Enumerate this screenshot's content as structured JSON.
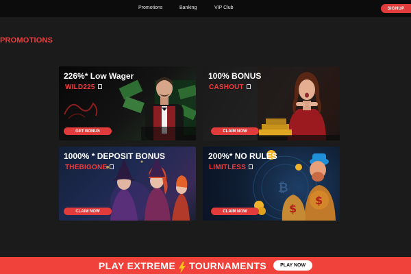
{
  "nav": {
    "promotions": "Promotions",
    "banking": "Banking",
    "vip": "VIP Club",
    "signup": "SIGNUP"
  },
  "page": {
    "title": "PROMOTIONS"
  },
  "cards": [
    {
      "title": "226%* Low Wager",
      "code": "WILD225",
      "button": "GET BONUS"
    },
    {
      "title": "100% BONUS",
      "code": "CASHOUT",
      "button": "CLAIM NOW"
    },
    {
      "title": "1000% * DEPOSIT BONUS",
      "code": "THEBIGONE",
      "button": "CLAIM NOW"
    },
    {
      "title": "200%* NO RULES",
      "code": "LIMITLESS",
      "button": "CLAIM NOW"
    }
  ],
  "banner": {
    "left": "PLAY EXTREME",
    "right": "TOURNAMENTS",
    "button": "PLAY NOW"
  },
  "colors": {
    "accent": "#e23b3b",
    "background": "#1b1b1b",
    "topbar": "#0c0c0c"
  },
  "icons": {
    "copy": "copy-icon",
    "bolt": "lightning-bolt-icon"
  }
}
